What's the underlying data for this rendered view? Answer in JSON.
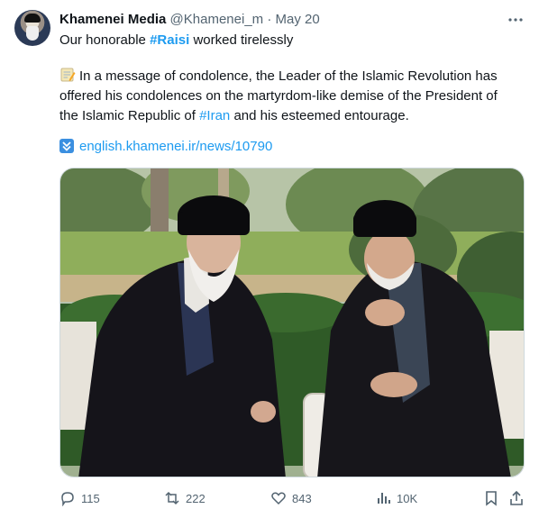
{
  "tweet": {
    "author_name": "Khamenei Media",
    "author_handle": "@Khamenei_m",
    "separator": "·",
    "date": "May 20",
    "line1_before": "Our honorable ",
    "line1_hashtag": "#Raisi",
    "line1_after": " worked tirelessly",
    "para_before": "In a message of condolence, the Leader of the Islamic Revolution has offered his condolences on the martyrdom-like demise of the President of the Islamic Republic of ",
    "para_hashtag": "#Iran",
    "para_after": " and his esteemed entourage.",
    "link_text": "english.khamenei.ir/news/10790"
  },
  "actions": {
    "replies": "115",
    "reposts": "222",
    "likes": "843",
    "views": "10K"
  },
  "colors": {
    "accent": "#1d9bf0",
    "text": "#0f1419",
    "muted": "#536471"
  },
  "icons": [
    "more-icon",
    "memo-icon",
    "down-arrow-icon",
    "reply-icon",
    "repost-icon",
    "like-icon",
    "views-icon",
    "bookmark-icon",
    "share-icon"
  ]
}
